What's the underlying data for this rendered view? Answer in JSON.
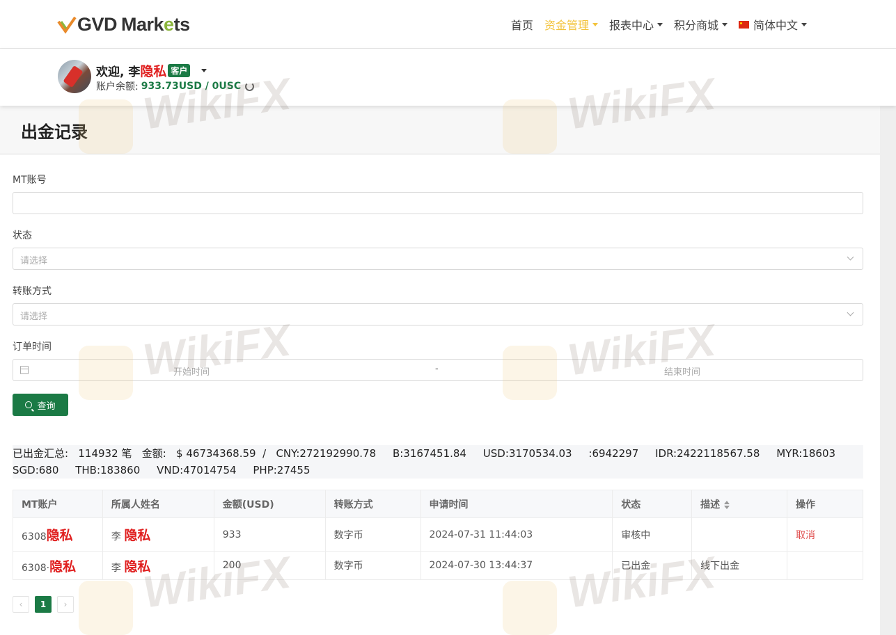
{
  "brand": {
    "logo_prefix": "GVD",
    "logo_main": "Mark",
    "logo_accent": "e",
    "logo_tail": "ts"
  },
  "nav": {
    "home": "首页",
    "funds": "资金管理",
    "reports": "报表中心",
    "points_mall": "积分商城",
    "language": "简体中文"
  },
  "user": {
    "welcome": "欢迎, 李",
    "name_redacted": "隐私",
    "role": "客户",
    "balance_label": "账户余额:",
    "balance_value": "933.73USD / 0USC"
  },
  "page": {
    "title": "出金记录"
  },
  "form": {
    "mt_account_label": "MT账号",
    "status_label": "状态",
    "status_placeholder": "请选择",
    "transfer_label": "转账方式",
    "transfer_placeholder": "请选择",
    "order_time_label": "订单时间",
    "start_placeholder": "开始时间",
    "date_separator": "-",
    "end_placeholder": "结束时间",
    "search_label": "查询"
  },
  "summary": {
    "line1": "已出金汇总:   114932 笔   金额:   $ 46734368.59  /   CNY:272192990.78     B:3167451.84     USD:3170534.03     :6942297     IDR:2422118567.58     MYR:18603",
    "line2": "SGD:680     THB:183860     VND:47014754     PHP:27455"
  },
  "table": {
    "headers": [
      "MT账户",
      "所属人姓名",
      "金额(USD)",
      "转账方式",
      "申请时间",
      "状态",
      "描述",
      "操作"
    ],
    "rows": [
      {
        "account_prefix": "6308",
        "account_redacted": "隐私",
        "owner_prefix": "李",
        "owner_redacted": "隐私",
        "amount": "933",
        "method": "数字币",
        "time": "2024-07-31 11:44:03",
        "status": "审核中",
        "desc": "",
        "action": "取消"
      },
      {
        "account_prefix": "6308·",
        "account_redacted": "隐私",
        "owner_prefix": "李",
        "owner_redacted": "隐私",
        "amount": "200",
        "method": "数字币",
        "time": "2024-07-30 13:44:37",
        "status": "已出金",
        "desc": "线下出金",
        "action": ""
      }
    ]
  },
  "pagination": {
    "current": "1",
    "prev": "‹",
    "next": "›"
  },
  "watermark": "WikiFX",
  "colors": {
    "primary": "#1b7a45",
    "nav_active": "#f3c33c",
    "redact": "#e02020",
    "cancel": "#e05050"
  }
}
